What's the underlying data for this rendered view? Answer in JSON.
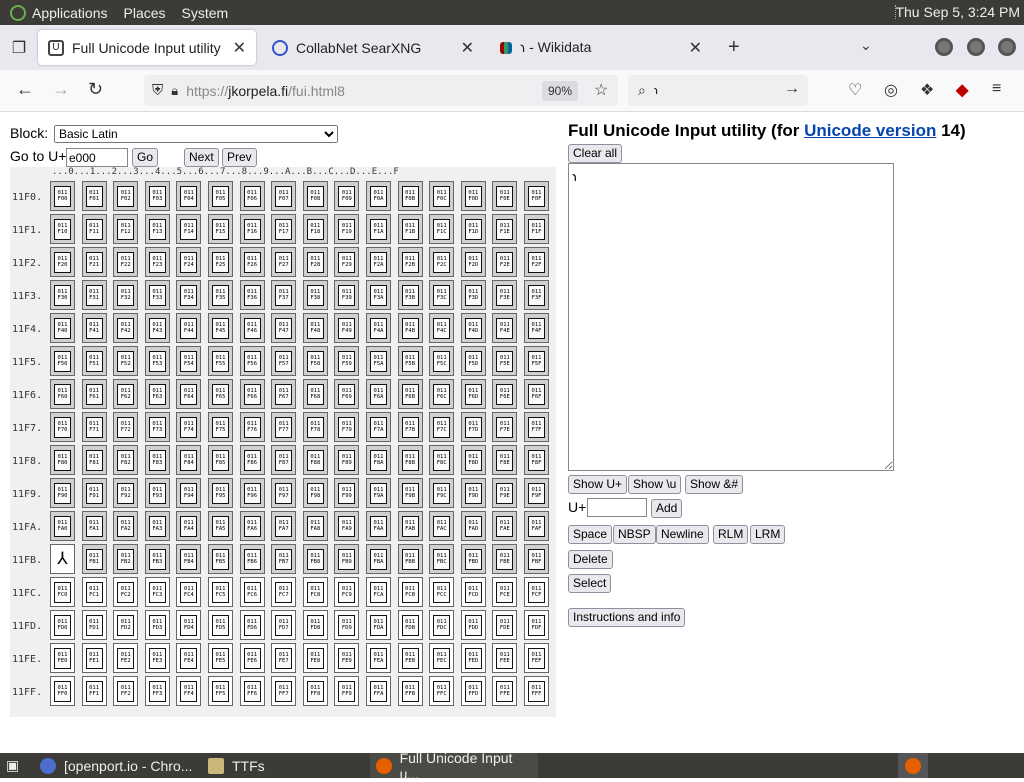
{
  "desktop": {
    "menus": [
      "Applications",
      "Places",
      "System"
    ],
    "clock": "Thu Sep  5,  3:24 PM"
  },
  "browser": {
    "tabs": [
      {
        "title": "Full Unicode Input utility",
        "active": true
      },
      {
        "title": "CollabNet SearXNG",
        "active": false
      },
      {
        "title": "𐑪 - Wikidata",
        "active": false
      }
    ],
    "url_scheme": "https://",
    "url_host": "jkorpela.fi",
    "url_path": "/fui.html8",
    "zoom": "90%",
    "search_text": "𐑪"
  },
  "page": {
    "block_label": "Block:",
    "block_selected": "Basic Latin",
    "goto_label": "Go to U+",
    "goto_value": "e000",
    "go_button": "Go",
    "next_button": "Next",
    "prev_button": "Prev",
    "title_prefix": "Full Unicode Input utility (for ",
    "title_link": "Unicode version",
    "title_suffix": " 14)",
    "clear_all": "Clear all",
    "output_text": "𐑪",
    "show_uplus": "Show U+",
    "show_backslash_u": "Show \\u",
    "show_amp": "Show &#",
    "uplus_label": "U+",
    "add_button": "Add",
    "space_button": "Space",
    "nbsp_button": "NBSP",
    "newline_button": "Newline",
    "rlm_button": "RLM",
    "lrm_button": "LRM",
    "delete_button": "Delete",
    "select_button": "Select",
    "instructions_button": "Instructions and info"
  },
  "grid": {
    "header": "...0...1...2...3...4...5...6...7...8...9...A...B...C...D...E...F",
    "row_prefix": "11F",
    "rows": [
      "0",
      "1",
      "2",
      "3",
      "4",
      "5",
      "6",
      "7",
      "8",
      "9",
      "A",
      "B",
      "C",
      "D",
      "E",
      "F"
    ],
    "columns": [
      "0",
      "1",
      "2",
      "3",
      "4",
      "5",
      "6",
      "7",
      "8",
      "9",
      "A",
      "B",
      "C",
      "D",
      "E",
      "F"
    ],
    "special_cells": {
      "11FB0": "⅄"
    },
    "white_rows_from": "C"
  },
  "taskbar": {
    "items": [
      {
        "label": "[openport.io - Chro..."
      },
      {
        "label": "TTFs"
      },
      {
        "label": "Full Unicode Input u..."
      }
    ]
  }
}
